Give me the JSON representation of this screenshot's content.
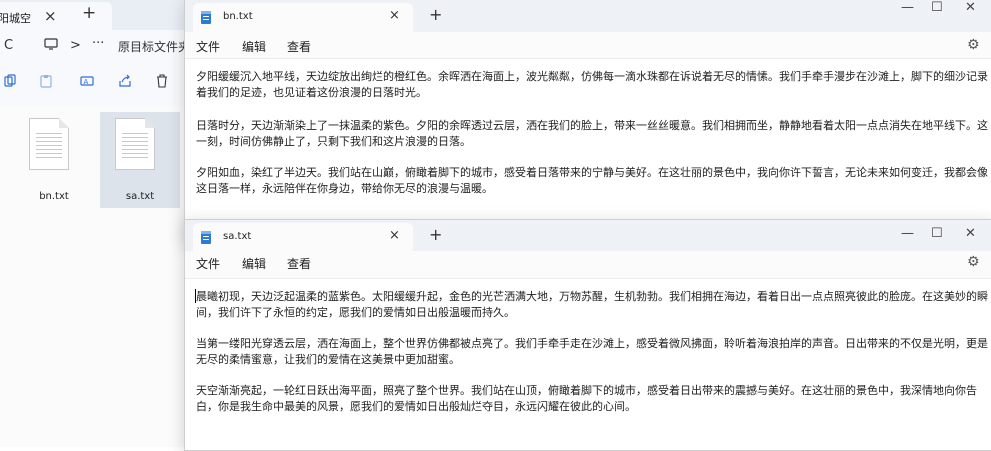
{
  "explorer": {
    "tab_title": "阳城空",
    "nav": {
      "back": "C",
      "sep": ">",
      "more": "···",
      "path": "原目标文件夹"
    },
    "files": [
      {
        "name": "bn.txt",
        "selected": false
      },
      {
        "name": "sa.txt",
        "selected": true
      }
    ]
  },
  "bn_window": {
    "tab_title": "bn.txt",
    "menu": {
      "file": "文件",
      "edit": "编辑",
      "view": "查看"
    },
    "paragraphs": [
      "夕阳缓缓沉入地平线，天边绽放出绚烂的橙红色。余晖洒在海面上，波光粼粼，仿佛每一滴水珠都在诉说着无尽的情愫。我们手牵手漫步在沙滩上，脚下的细沙记录着我们的足迹，也见证着这份浪漫的日落时光。",
      "日落时分，天边渐渐染上了一抹温柔的紫色。夕阳的余晖透过云层，洒在我们的脸上，带来一丝丝暖意。我们相拥而坐，静静地看着太阳一点点消失在地平线下。这一刻，时间仿佛静止了，只剩下我们和这片浪漫的日落。",
      "夕阳如血，染红了半边天。我们站在山巅，俯瞰着脚下的城市，感受着日落带来的宁静与美好。在这壮丽的景色中，我向你许下誓言，无论未来如何变迁，我都会像这日落一样，永远陪伴在你身边，带给你无尽的浪漫与温暖。"
    ]
  },
  "sa_window": {
    "tab_title": "sa.txt",
    "menu": {
      "file": "文件",
      "edit": "编辑",
      "view": "查看"
    },
    "paragraphs": [
      "晨曦初现，天边泛起温柔的蓝紫色。太阳缓缓升起，金色的光芒洒满大地，万物苏醒，生机勃勃。我们相拥在海边，看着日出一点点照亮彼此的脸庞。在这美妙的瞬间，我们许下了永恒的约定，愿我们的爱情如日出般温暖而持久。",
      "当第一缕阳光穿透云层，洒在海面上，整个世界仿佛都被点亮了。我们手牵手走在沙滩上，感受着微风拂面，聆听着海浪拍岸的声音。日出带来的不仅是光明，更是无尽的柔情蜜意，让我们的爱情在这美景中更加甜蜜。",
      "天空渐渐亮起，一轮红日跃出海平面，照亮了整个世界。我们站在山顶，俯瞰着脚下的城市，感受着日出带来的震撼与美好。在这壮丽的景色中，我深情地向你告白，你是我生命中最美的风景，愿我们的爱情如日出般灿烂夺目，永远闪耀在彼此的心间。"
    ]
  }
}
